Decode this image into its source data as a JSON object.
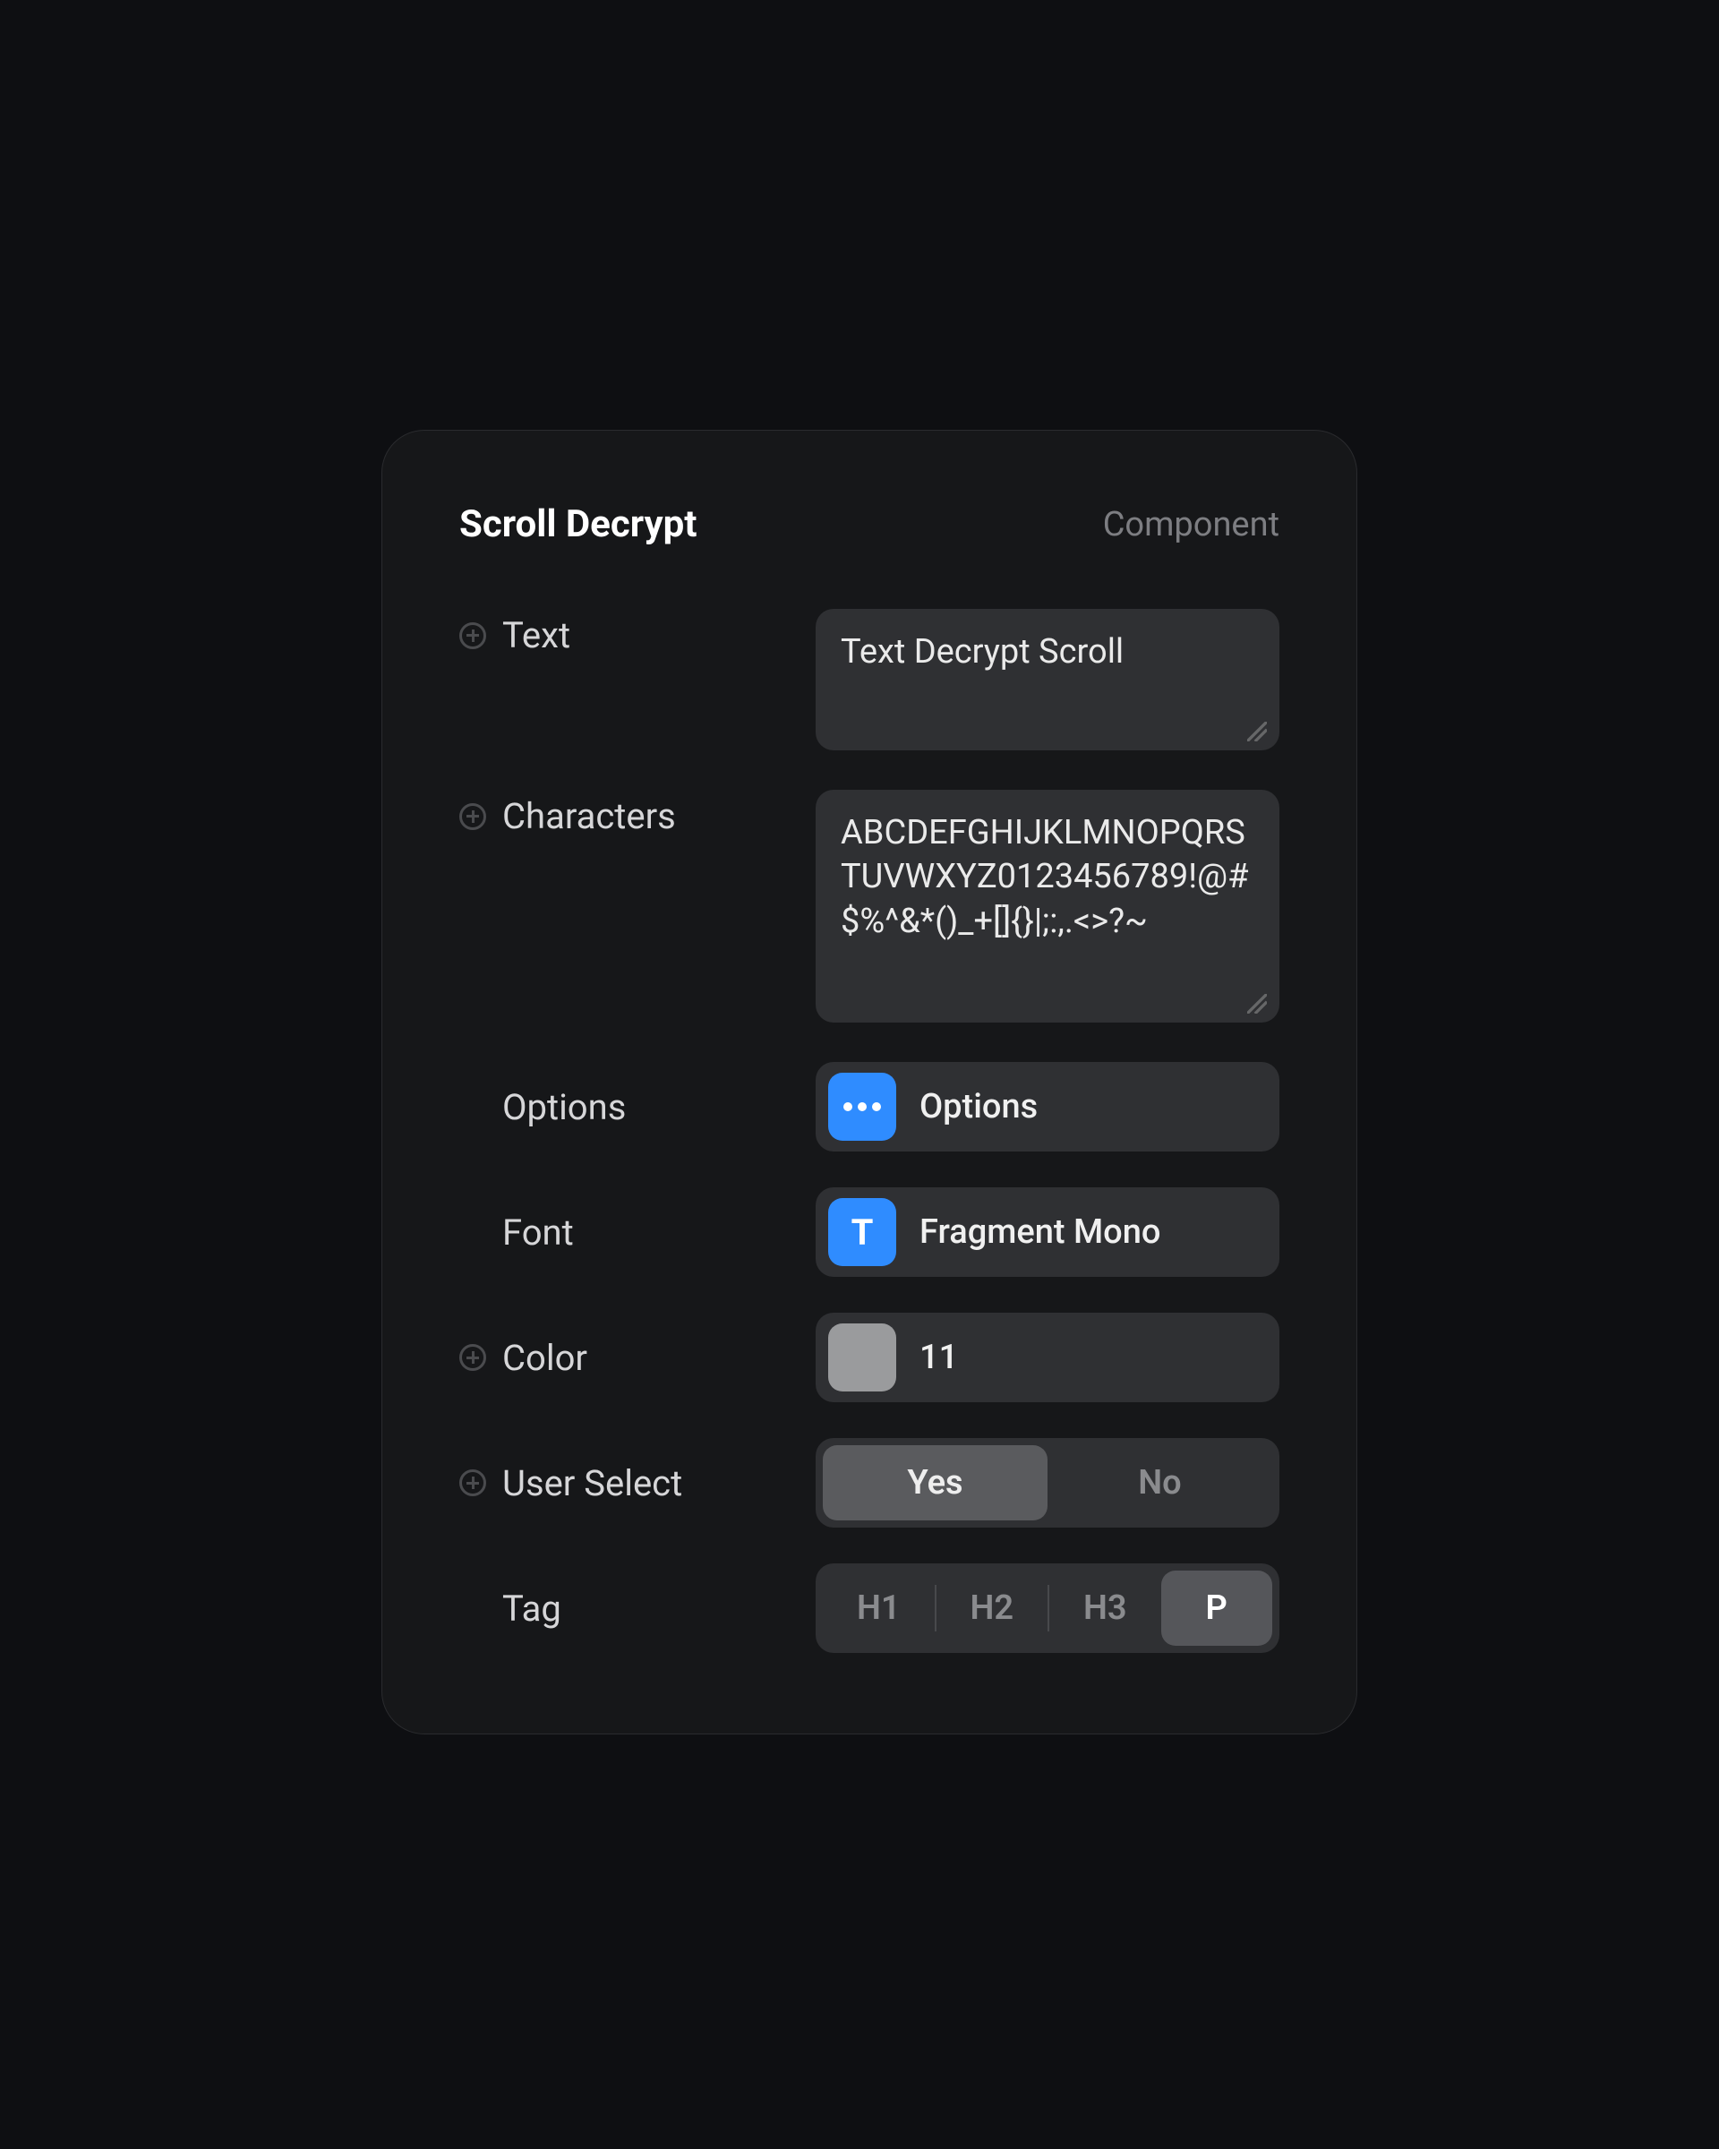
{
  "panel": {
    "title": "Scroll Decrypt",
    "subtitle": "Component"
  },
  "fields": {
    "text": {
      "label": "Text",
      "value": "Text Decrypt Scroll"
    },
    "characters": {
      "label": "Characters",
      "value": "ABCDEFGHIJKLMNOPQRSTUVWXYZ0123456789!@#$%^&*()_+[]{}|;:,.<>?~"
    },
    "options": {
      "label": "Options",
      "chip_icon": "ellipsis-icon",
      "value": "Options"
    },
    "font": {
      "label": "Font",
      "chip_letter": "T",
      "value": "Fragment Mono"
    },
    "color": {
      "label": "Color",
      "swatch": "#9a9b9d",
      "value": "11"
    },
    "user_select": {
      "label": "User Select",
      "options": [
        "Yes",
        "No"
      ],
      "selected": "Yes"
    },
    "tag": {
      "label": "Tag",
      "options": [
        "H1",
        "H2",
        "H3",
        "P"
      ],
      "selected": "P"
    }
  },
  "colors": {
    "accent_blue": "#2f8cff",
    "panel_bg": "#161719",
    "control_bg": "#2f3033"
  }
}
